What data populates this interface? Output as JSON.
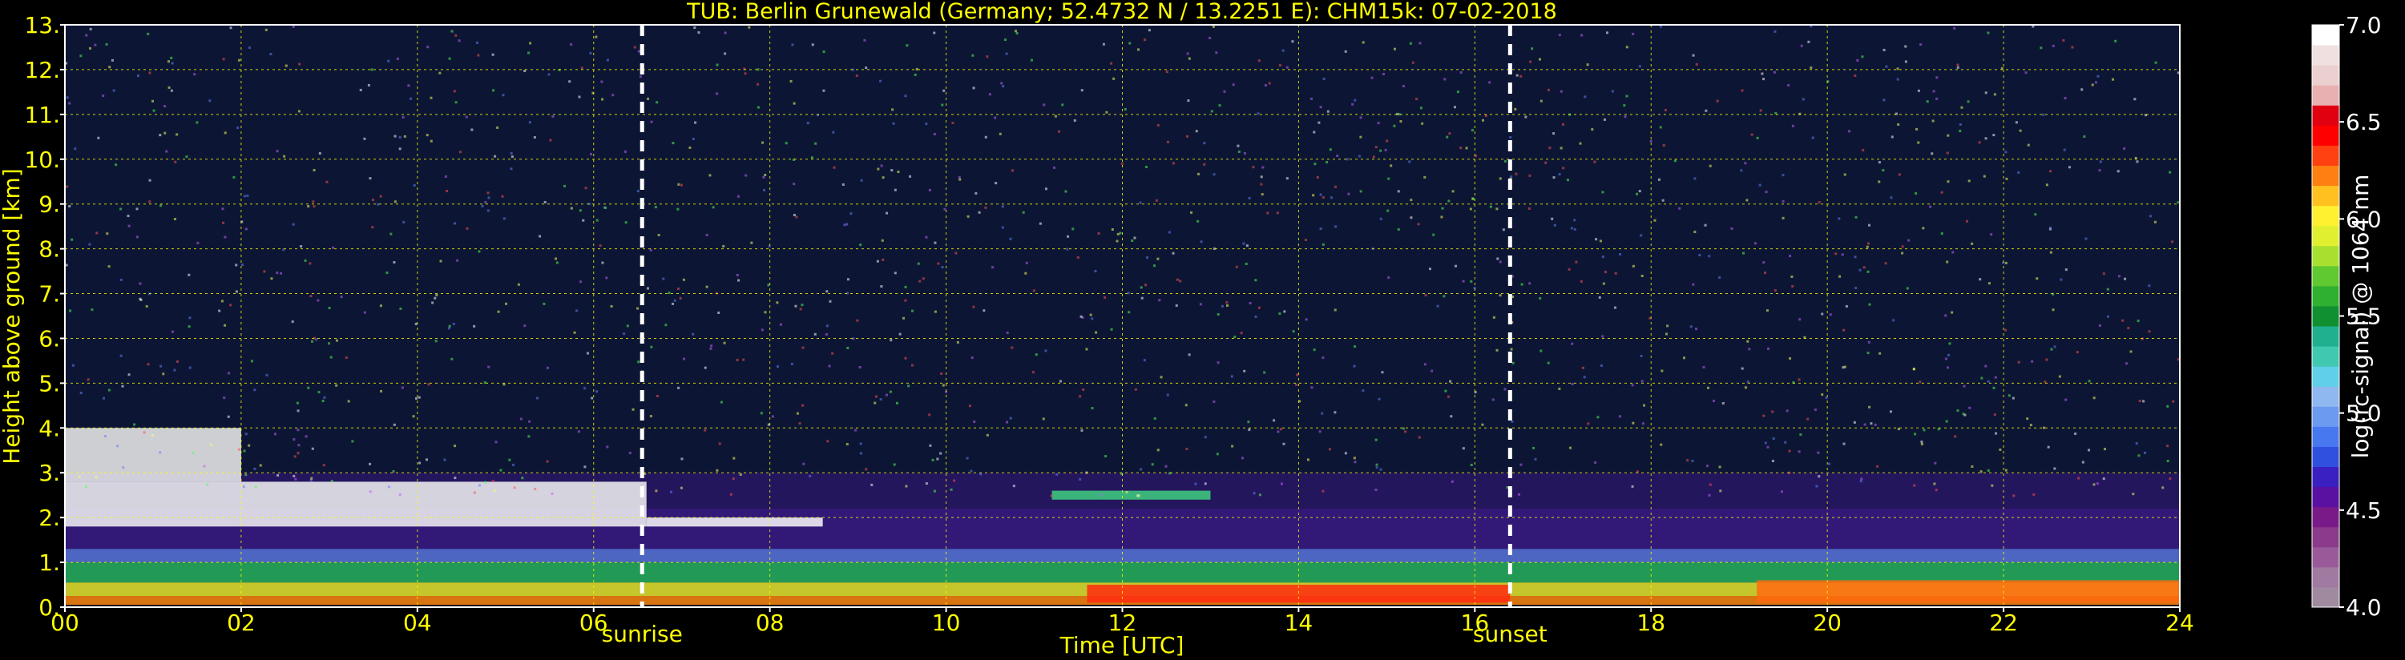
{
  "chart_data": {
    "type": "heatmap",
    "title": "TUB: Berlin Grunewald (Germany; 52.4732 N / 13.2251 E):    CHM15k: 07-02-2018",
    "xlabel": "Time [UTC]",
    "ylabel": "Height above ground [km]",
    "xlim": [
      0,
      24
    ],
    "ylim": [
      0,
      13
    ],
    "x_ticks": [
      "00",
      "02",
      "04",
      "06",
      "08",
      "10",
      "12",
      "14",
      "16",
      "18",
      "20",
      "22",
      "24"
    ],
    "y_ticks": [
      "0.",
      "1.",
      "2.",
      "3.",
      "4.",
      "5.",
      "6.",
      "7.",
      "8.",
      "9.",
      "10.",
      "11.",
      "12.",
      "13."
    ],
    "grid": true,
    "events": [
      {
        "label": "sunrise",
        "time": 6.55
      },
      {
        "label": "sunset",
        "time": 16.4
      }
    ],
    "colorbar": {
      "label": "log(rc-signal) @ 1064 nm",
      "range": [
        4.0,
        7.0
      ],
      "ticks": [
        "4.0",
        "4.5",
        "5.0",
        "5.5",
        "6.0",
        "6.5",
        "7.0"
      ],
      "colors": [
        "#a08aa0",
        "#a07aa0",
        "#9a5a9a",
        "#8c3a8c",
        "#7a1a88",
        "#5a10a0",
        "#3a20c0",
        "#3050e0",
        "#4878f0",
        "#6c9af0",
        "#90b8f0",
        "#5fd0e8",
        "#40c8b0",
        "#20b090",
        "#109030",
        "#30b030",
        "#60c830",
        "#a8e030",
        "#e0f030",
        "#fff030",
        "#ffc020",
        "#ff8010",
        "#ff4010",
        "#ff0000",
        "#e00010",
        "#e8b0b0",
        "#ecd0d0",
        "#f0e0e0",
        "#ffffff"
      ]
    }
  }
}
